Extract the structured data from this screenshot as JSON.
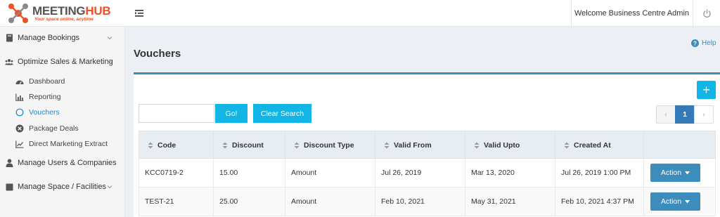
{
  "brand": {
    "name_part1": "MEETING",
    "name_part2": "HUB",
    "tagline": "Your space online, anytime",
    "accent_color": "#e8532b"
  },
  "header": {
    "welcome_text": "Welcome Business Centre Admin",
    "menu_icon": "menu-toggle-icon",
    "logout_icon": "power-icon"
  },
  "sidebar": {
    "groups": [
      {
        "label": "Manage Bookings",
        "icon": "book-icon"
      },
      {
        "label": "Optimize Sales & Marketing",
        "icon": "users-icon"
      },
      {
        "label": "Manage Users & Companies",
        "icon": "user-icon"
      },
      {
        "label": "Manage Space / Facilities",
        "icon": "square-icon"
      }
    ],
    "subitems": [
      {
        "label": "Dashboard",
        "icon": "dashboard-icon"
      },
      {
        "label": "Reporting",
        "icon": "bar-chart-icon"
      },
      {
        "label": "Vouchers",
        "icon": "circle-icon",
        "active": true
      },
      {
        "label": "Package Deals",
        "icon": "times-circle-icon"
      },
      {
        "label": "Direct Marketing Extract",
        "icon": "line-chart-icon"
      }
    ]
  },
  "page": {
    "title": "Vouchers",
    "help_label": "Help"
  },
  "toolbar": {
    "add_label": "+",
    "search_value": "",
    "search_placeholder": "",
    "go_label": "Go!",
    "clear_label": "Clear Search"
  },
  "pagination": {
    "prev": "‹",
    "current": "1",
    "next": "›"
  },
  "table": {
    "columns": [
      "Code",
      "Discount",
      "Discount Type",
      "Valid From",
      "Valid Upto",
      "Created At"
    ],
    "rows": [
      {
        "code": "KCC0719-2",
        "discount": "15.00",
        "type": "Amount",
        "valid_from": "Jul 26, 2019",
        "valid_upto": "Mar 13, 2020",
        "created_at": "Jul 26, 2019 1:00 PM",
        "action": "Action"
      },
      {
        "code": "TEST-21",
        "discount": "25.00",
        "type": "Amount",
        "valid_from": "Feb 10, 2021",
        "valid_upto": "May 31, 2021",
        "created_at": "Feb 10, 2021 4:37 PM",
        "action": "Action"
      }
    ]
  },
  "colors": {
    "primary": "#3c8dbc",
    "cyan": "#12b6e6",
    "active_link": "#1e88c7"
  }
}
